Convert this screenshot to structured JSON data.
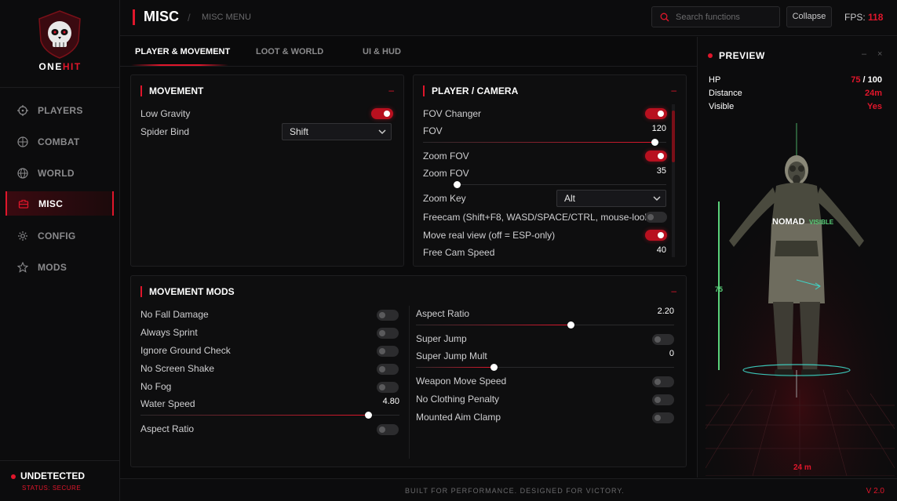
{
  "app": {
    "logo_text_a": "ONE",
    "logo_text_b": "HIT"
  },
  "sidebar": {
    "items": [
      {
        "label": "PLAYERS",
        "icon": "crosshair-icon"
      },
      {
        "label": "COMBAT",
        "icon": "target-icon"
      },
      {
        "label": "WORLD",
        "icon": "globe-icon"
      },
      {
        "label": "MISC",
        "icon": "briefcase-icon",
        "active": true
      },
      {
        "label": "CONFIG",
        "icon": "gear-icon"
      },
      {
        "label": "MODS",
        "icon": "star-icon"
      }
    ],
    "status": {
      "title": "UNDETECTED",
      "subtitle": "STATUS: SECURE"
    }
  },
  "header": {
    "title": "MISC",
    "slash": "/",
    "subtitle": "MISC MENU",
    "search_placeholder": "Search functions",
    "collapse_label": "Collapse",
    "fps_label": "FPS:",
    "fps_value": "118"
  },
  "tabs": [
    {
      "label": "PLAYER & MOVEMENT",
      "active": true
    },
    {
      "label": "LOOT & WORLD"
    },
    {
      "label": "UI & HUD"
    }
  ],
  "movement": {
    "title": "MOVEMENT",
    "min": "–",
    "low_gravity": {
      "label": "Low Gravity",
      "on": true
    },
    "spider_bind": {
      "label": "Spider Bind",
      "value": "Shift"
    }
  },
  "camera": {
    "title": "PLAYER / CAMERA",
    "min": "–",
    "fov_changer": {
      "label": "FOV Changer",
      "on": true
    },
    "fov": {
      "label": "FOV",
      "value": "120",
      "fraction": 0.95
    },
    "zoom_fov": {
      "label": "Zoom FOV",
      "on": true
    },
    "zoom_fov_slider": {
      "label": "Zoom FOV",
      "value": "35",
      "fraction": 0.02
    },
    "zoom_key": {
      "label": "Zoom Key",
      "value": "Alt"
    },
    "freecam": {
      "label": "Freecam (Shift+F8, WASD/SPACE/CTRL, mouse-look)",
      "on": false
    },
    "move_real_view": {
      "label": "Move real view (off = ESP-only)",
      "on": true
    },
    "free_cam_speed": {
      "label": "Free Cam Speed",
      "value": "40"
    }
  },
  "mods": {
    "title": "MOVEMENT MODS",
    "min": "–",
    "left": [
      {
        "label": "No Fall Damage",
        "on": false
      },
      {
        "label": "Always Sprint",
        "on": false
      },
      {
        "label": "Ignore Ground Check",
        "on": false
      },
      {
        "label": "No Screen Shake",
        "on": false
      },
      {
        "label": "No Fog",
        "on": false
      }
    ],
    "water_speed": {
      "label": "Water Speed",
      "value": "4.80",
      "fraction": 0.88
    },
    "aspect_ratio_toggle": {
      "label": "Aspect Ratio",
      "on": false
    },
    "aspect_ratio": {
      "label": "Aspect Ratio",
      "value": "2.20",
      "fraction": 0.6
    },
    "super_jump": {
      "label": "Super Jump",
      "on": false
    },
    "super_jump_mult": {
      "label": "Super Jump Mult",
      "value": "0",
      "fraction": 0.3
    },
    "right": [
      {
        "label": "Weapon Move Speed",
        "on": false
      },
      {
        "label": "No Clothing Penalty",
        "on": false
      },
      {
        "label": "Mounted Aim Clamp",
        "on": false
      }
    ]
  },
  "preview": {
    "title": "PREVIEW",
    "minimize": "–",
    "close": "×",
    "hp_label": "HP",
    "hp_value": "75",
    "hp_sep": "/",
    "hp_max": "100",
    "distance_label": "Distance",
    "distance_value": "24m",
    "visible_label": "Visible",
    "visible_value": "Yes",
    "name": "NOMAD",
    "visible_tag": "VISIBLE",
    "hp_bar_value": "75",
    "ground_distance": "24 m"
  },
  "footer": {
    "tagline": "BUILT FOR PERFORMANCE. DESIGNED FOR VICTORY.",
    "version": "V 2.0"
  },
  "colors": {
    "accent": "#e0162b",
    "background": "#0a0a0b",
    "panel": "#0e0e0f",
    "esp_green": "#5ad27a"
  }
}
